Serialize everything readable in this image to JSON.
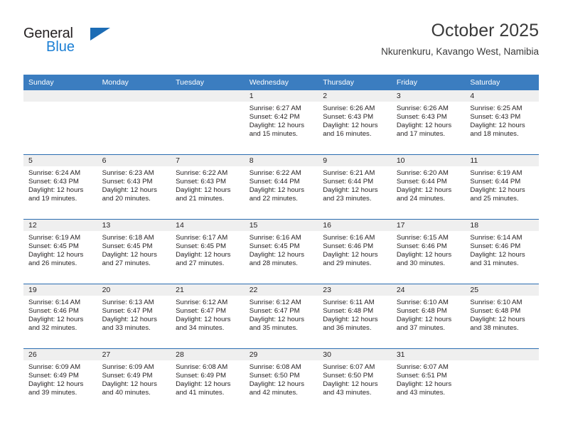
{
  "brand": {
    "name_top": "General",
    "name_bottom": "Blue",
    "triangle_color": "#1c6cb5",
    "blue_color": "#1b7fd4"
  },
  "header": {
    "title": "October 2025",
    "subtitle": "Nkurenkuru, Kavango West, Namibia"
  },
  "theme": {
    "header_bg": "#3b7dc0",
    "row_divider": "#2a6cb0",
    "daynum_band": "#efefef",
    "text": "#231f20"
  },
  "weekdays": [
    "Sunday",
    "Monday",
    "Tuesday",
    "Wednesday",
    "Thursday",
    "Friday",
    "Saturday"
  ],
  "weeks": [
    [
      {
        "day": "",
        "sunrise": "",
        "sunset": "",
        "daylight_line1": "",
        "daylight_line2": ""
      },
      {
        "day": "",
        "sunrise": "",
        "sunset": "",
        "daylight_line1": "",
        "daylight_line2": ""
      },
      {
        "day": "",
        "sunrise": "",
        "sunset": "",
        "daylight_line1": "",
        "daylight_line2": ""
      },
      {
        "day": "1",
        "sunrise": "Sunrise: 6:27 AM",
        "sunset": "Sunset: 6:42 PM",
        "daylight_line1": "Daylight: 12 hours",
        "daylight_line2": "and 15 minutes."
      },
      {
        "day": "2",
        "sunrise": "Sunrise: 6:26 AM",
        "sunset": "Sunset: 6:43 PM",
        "daylight_line1": "Daylight: 12 hours",
        "daylight_line2": "and 16 minutes."
      },
      {
        "day": "3",
        "sunrise": "Sunrise: 6:26 AM",
        "sunset": "Sunset: 6:43 PM",
        "daylight_line1": "Daylight: 12 hours",
        "daylight_line2": "and 17 minutes."
      },
      {
        "day": "4",
        "sunrise": "Sunrise: 6:25 AM",
        "sunset": "Sunset: 6:43 PM",
        "daylight_line1": "Daylight: 12 hours",
        "daylight_line2": "and 18 minutes."
      }
    ],
    [
      {
        "day": "5",
        "sunrise": "Sunrise: 6:24 AM",
        "sunset": "Sunset: 6:43 PM",
        "daylight_line1": "Daylight: 12 hours",
        "daylight_line2": "and 19 minutes."
      },
      {
        "day": "6",
        "sunrise": "Sunrise: 6:23 AM",
        "sunset": "Sunset: 6:43 PM",
        "daylight_line1": "Daylight: 12 hours",
        "daylight_line2": "and 20 minutes."
      },
      {
        "day": "7",
        "sunrise": "Sunrise: 6:22 AM",
        "sunset": "Sunset: 6:43 PM",
        "daylight_line1": "Daylight: 12 hours",
        "daylight_line2": "and 21 minutes."
      },
      {
        "day": "8",
        "sunrise": "Sunrise: 6:22 AM",
        "sunset": "Sunset: 6:44 PM",
        "daylight_line1": "Daylight: 12 hours",
        "daylight_line2": "and 22 minutes."
      },
      {
        "day": "9",
        "sunrise": "Sunrise: 6:21 AM",
        "sunset": "Sunset: 6:44 PM",
        "daylight_line1": "Daylight: 12 hours",
        "daylight_line2": "and 23 minutes."
      },
      {
        "day": "10",
        "sunrise": "Sunrise: 6:20 AM",
        "sunset": "Sunset: 6:44 PM",
        "daylight_line1": "Daylight: 12 hours",
        "daylight_line2": "and 24 minutes."
      },
      {
        "day": "11",
        "sunrise": "Sunrise: 6:19 AM",
        "sunset": "Sunset: 6:44 PM",
        "daylight_line1": "Daylight: 12 hours",
        "daylight_line2": "and 25 minutes."
      }
    ],
    [
      {
        "day": "12",
        "sunrise": "Sunrise: 6:19 AM",
        "sunset": "Sunset: 6:45 PM",
        "daylight_line1": "Daylight: 12 hours",
        "daylight_line2": "and 26 minutes."
      },
      {
        "day": "13",
        "sunrise": "Sunrise: 6:18 AM",
        "sunset": "Sunset: 6:45 PM",
        "daylight_line1": "Daylight: 12 hours",
        "daylight_line2": "and 27 minutes."
      },
      {
        "day": "14",
        "sunrise": "Sunrise: 6:17 AM",
        "sunset": "Sunset: 6:45 PM",
        "daylight_line1": "Daylight: 12 hours",
        "daylight_line2": "and 27 minutes."
      },
      {
        "day": "15",
        "sunrise": "Sunrise: 6:16 AM",
        "sunset": "Sunset: 6:45 PM",
        "daylight_line1": "Daylight: 12 hours",
        "daylight_line2": "and 28 minutes."
      },
      {
        "day": "16",
        "sunrise": "Sunrise: 6:16 AM",
        "sunset": "Sunset: 6:46 PM",
        "daylight_line1": "Daylight: 12 hours",
        "daylight_line2": "and 29 minutes."
      },
      {
        "day": "17",
        "sunrise": "Sunrise: 6:15 AM",
        "sunset": "Sunset: 6:46 PM",
        "daylight_line1": "Daylight: 12 hours",
        "daylight_line2": "and 30 minutes."
      },
      {
        "day": "18",
        "sunrise": "Sunrise: 6:14 AM",
        "sunset": "Sunset: 6:46 PM",
        "daylight_line1": "Daylight: 12 hours",
        "daylight_line2": "and 31 minutes."
      }
    ],
    [
      {
        "day": "19",
        "sunrise": "Sunrise: 6:14 AM",
        "sunset": "Sunset: 6:46 PM",
        "daylight_line1": "Daylight: 12 hours",
        "daylight_line2": "and 32 minutes."
      },
      {
        "day": "20",
        "sunrise": "Sunrise: 6:13 AM",
        "sunset": "Sunset: 6:47 PM",
        "daylight_line1": "Daylight: 12 hours",
        "daylight_line2": "and 33 minutes."
      },
      {
        "day": "21",
        "sunrise": "Sunrise: 6:12 AM",
        "sunset": "Sunset: 6:47 PM",
        "daylight_line1": "Daylight: 12 hours",
        "daylight_line2": "and 34 minutes."
      },
      {
        "day": "22",
        "sunrise": "Sunrise: 6:12 AM",
        "sunset": "Sunset: 6:47 PM",
        "daylight_line1": "Daylight: 12 hours",
        "daylight_line2": "and 35 minutes."
      },
      {
        "day": "23",
        "sunrise": "Sunrise: 6:11 AM",
        "sunset": "Sunset: 6:48 PM",
        "daylight_line1": "Daylight: 12 hours",
        "daylight_line2": "and 36 minutes."
      },
      {
        "day": "24",
        "sunrise": "Sunrise: 6:10 AM",
        "sunset": "Sunset: 6:48 PM",
        "daylight_line1": "Daylight: 12 hours",
        "daylight_line2": "and 37 minutes."
      },
      {
        "day": "25",
        "sunrise": "Sunrise: 6:10 AM",
        "sunset": "Sunset: 6:48 PM",
        "daylight_line1": "Daylight: 12 hours",
        "daylight_line2": "and 38 minutes."
      }
    ],
    [
      {
        "day": "26",
        "sunrise": "Sunrise: 6:09 AM",
        "sunset": "Sunset: 6:49 PM",
        "daylight_line1": "Daylight: 12 hours",
        "daylight_line2": "and 39 minutes."
      },
      {
        "day": "27",
        "sunrise": "Sunrise: 6:09 AM",
        "sunset": "Sunset: 6:49 PM",
        "daylight_line1": "Daylight: 12 hours",
        "daylight_line2": "and 40 minutes."
      },
      {
        "day": "28",
        "sunrise": "Sunrise: 6:08 AM",
        "sunset": "Sunset: 6:49 PM",
        "daylight_line1": "Daylight: 12 hours",
        "daylight_line2": "and 41 minutes."
      },
      {
        "day": "29",
        "sunrise": "Sunrise: 6:08 AM",
        "sunset": "Sunset: 6:50 PM",
        "daylight_line1": "Daylight: 12 hours",
        "daylight_line2": "and 42 minutes."
      },
      {
        "day": "30",
        "sunrise": "Sunrise: 6:07 AM",
        "sunset": "Sunset: 6:50 PM",
        "daylight_line1": "Daylight: 12 hours",
        "daylight_line2": "and 43 minutes."
      },
      {
        "day": "31",
        "sunrise": "Sunrise: 6:07 AM",
        "sunset": "Sunset: 6:51 PM",
        "daylight_line1": "Daylight: 12 hours",
        "daylight_line2": "and 43 minutes."
      },
      {
        "day": "",
        "sunrise": "",
        "sunset": "",
        "daylight_line1": "",
        "daylight_line2": ""
      }
    ]
  ]
}
